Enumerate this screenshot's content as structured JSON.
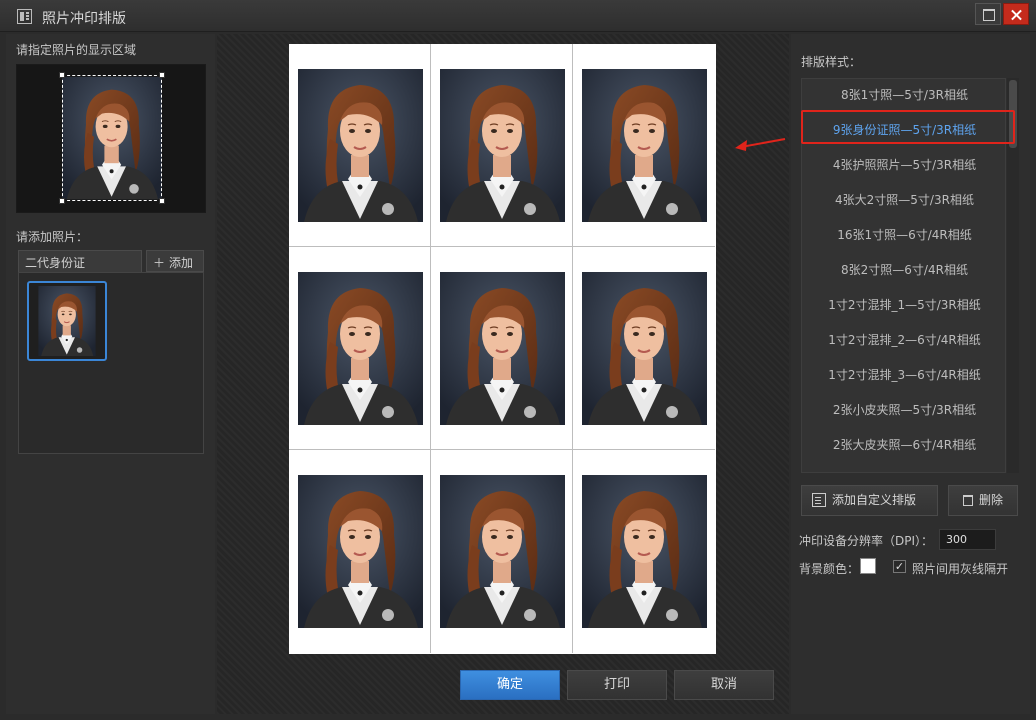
{
  "window": {
    "title": "照片冲印排版"
  },
  "left": {
    "display_region_label": "请指定照片的显示区域",
    "add_photo_label": "请添加照片：",
    "tab_label": "二代身份证",
    "add_button_label": "添加"
  },
  "layout_styles": {
    "label": "排版样式：",
    "items": [
      "8张1寸照—5寸/3R相纸",
      "9张身份证照—5寸/3R相纸",
      "4张护照照片—5寸/3R相纸",
      "4张大2寸照—5寸/3R相纸",
      "16张1寸照—6寸/4R相纸",
      "8张2寸照—6寸/4R相纸",
      "1寸2寸混排_1—5寸/3R相纸",
      "1寸2寸混排_2—6寸/4R相纸",
      "1寸2寸混排_3—6寸/4R相纸",
      "2张小皮夹照—5寸/3R相纸",
      "2张大皮夹照—6寸/4R相纸"
    ],
    "selected_index": 1
  },
  "right": {
    "add_custom_label": "添加自定义排版",
    "delete_label": "删除",
    "dpi_label": "冲印设备分辨率（DPI）：",
    "dpi_value": "300",
    "bg_color_label": "背景颜色：",
    "bg_color": "#ffffff",
    "gray_line_label": "照片间用灰线隔开",
    "gray_line_checked": true
  },
  "footer": {
    "ok_label": "确定",
    "print_label": "打印",
    "cancel_label": "取消"
  },
  "colors": {
    "accent": "#3b86d6",
    "highlight": "#e0241b"
  }
}
